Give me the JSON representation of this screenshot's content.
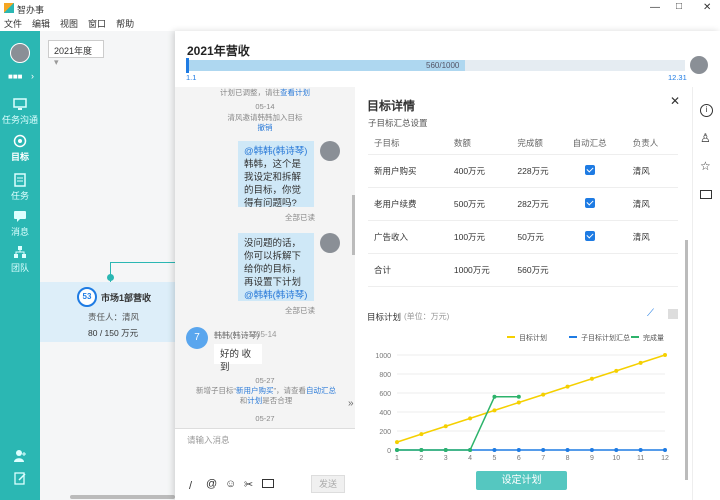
{
  "app": {
    "title": "智办事",
    "window_controls": [
      "—",
      "□",
      "✕"
    ]
  },
  "menu": [
    "文件",
    "编辑",
    "视图",
    "窗口",
    "帮助"
  ],
  "sidebar": {
    "user": "■■■",
    "items": [
      {
        "label": "任务沟通",
        "icon": "monitor-icon"
      },
      {
        "label": "目标",
        "icon": "target-icon"
      },
      {
        "label": "任务",
        "icon": "doc-icon"
      },
      {
        "label": "消息",
        "icon": "chat-icon"
      },
      {
        "label": "团队",
        "icon": "team-icon"
      }
    ]
  },
  "canvas": {
    "year": "2021年度",
    "node": {
      "badge": "53",
      "title": "市场1部营收",
      "owner": "责任人：清风",
      "amount": "80 / 150 万元"
    }
  },
  "dialog": {
    "title": "2021年营收",
    "progress": {
      "label": "560/1000",
      "fraction": 0.56,
      "start": "1.1",
      "end": "12.31"
    }
  },
  "chat": {
    "sys1": "计划已调整，请往",
    "sys1_link": "查看计划",
    "date1": "05-14",
    "sys2": "清风邀请韩韩加入目标",
    "sys2_link": "撤销",
    "msg1": {
      "mention": "@韩韩(韩诗琴)",
      "text": "韩韩，这个是我设定和拆解的目标，你觉得有问题吗?",
      "status": "全部已读"
    },
    "msg2": {
      "text": "没问题的话，你可以拆解下给你的目标，再设置下计划",
      "mention": "@韩韩(韩诗琴)",
      "status": "全部已读"
    },
    "msg3": {
      "name": "韩韩(韩诗琴)",
      "time": "05-14",
      "avatar": "7",
      "text": "好的 收到"
    },
    "date2": "05-27",
    "sys3_pre": "新增子目标“",
    "sys3_link": "新用户购买",
    "sys3_post": "”，请查看",
    "sys3_link2": "自动汇总",
    "sys3_mid": "和",
    "sys3_link3": "计划",
    "sys3_end": "是否合理",
    "date3": "05-27",
    "input_placeholder": "请输入消息",
    "send": "发送"
  },
  "detail": {
    "title": "目标详情",
    "section": "子目标汇总设置",
    "headers": [
      "子目标",
      "数额",
      "完成额",
      "自动汇总",
      "负责人"
    ],
    "rows": [
      {
        "name": "新用户购买",
        "amount": "400万元",
        "done": "228万元",
        "auto": true,
        "owner": "清风"
      },
      {
        "name": "老用户续费",
        "amount": "500万元",
        "done": "282万元",
        "auto": true,
        "owner": "清风"
      },
      {
        "name": "广告收入",
        "amount": "100万元",
        "done": "50万元",
        "auto": true,
        "owner": "清风"
      },
      {
        "name": "合计",
        "amount": "1000万元",
        "done": "560万元",
        "auto": false,
        "owner": ""
      }
    ],
    "plan_label": "目标计划",
    "plan_unit": "(单位：万元)",
    "set_plan": "设定计划"
  },
  "chart_data": {
    "type": "line",
    "x": [
      1,
      2,
      3,
      4,
      5,
      6,
      7,
      8,
      9,
      10,
      11,
      12
    ],
    "ylim": [
      0,
      1000
    ],
    "yticks": [
      0,
      200,
      400,
      600,
      800,
      1000
    ],
    "series": [
      {
        "name": "目标计划",
        "color": "#f5d000",
        "values": [
          83,
          167,
          250,
          333,
          417,
          500,
          583,
          667,
          750,
          833,
          917,
          1000
        ]
      },
      {
        "name": "子目标计划汇总",
        "color": "#1e7be3",
        "values": [
          0,
          0,
          0,
          0,
          0,
          0,
          0,
          0,
          0,
          0,
          0,
          0
        ]
      },
      {
        "name": "完成量",
        "color": "#2db36b",
        "values": [
          0,
          0,
          0,
          0,
          560,
          560
        ]
      }
    ]
  }
}
